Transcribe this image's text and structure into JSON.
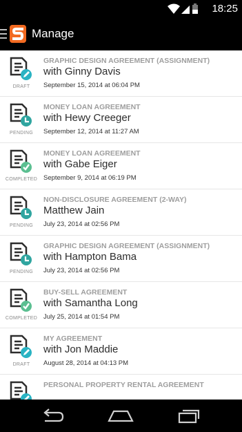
{
  "status_bar": {
    "time": "18:25",
    "icons": [
      "wifi-icon",
      "signal-icon",
      "battery-icon"
    ]
  },
  "app_bar": {
    "title": "Manage",
    "menu_icon": "hamburger-icon",
    "logo_icon": "s-logo-icon",
    "accent_color": "#f26a21"
  },
  "colors": {
    "draft": "#29b3c3",
    "pending": "#2fa5a0",
    "completed": "#5bbf91"
  },
  "agreements": [
    {
      "type": "GRAPHIC DESIGN AGREEMENT (ASSIGNMENT)",
      "party": "with Ginny Davis",
      "date": "September 15, 2014 at 06:04 PM",
      "status": "DRAFT",
      "badge_icon": "pencil-icon"
    },
    {
      "type": "MONEY LOAN AGREEMENT",
      "party": "with Hewy Creeger",
      "date": "September 12, 2014 at 11:27 AM",
      "status": "PENDING",
      "badge_icon": "clock-icon"
    },
    {
      "type": "MONEY LOAN AGREEMENT",
      "party": "with Gabe Eiger",
      "date": "September 9, 2014 at 06:19 PM",
      "status": "COMPLETED",
      "badge_icon": "checkmark-icon"
    },
    {
      "type": "NON-DISCLOSURE AGREEMENT (2-WAY)",
      "party": "Matthew Jain",
      "date": "July 23, 2014 at 02:56 PM",
      "status": "PENDING",
      "badge_icon": "clock-icon"
    },
    {
      "type": "GRAPHIC DESIGN AGREEMENT (ASSIGNMENT)",
      "party": "with Hampton Bama",
      "date": "July 23, 2014 at 02:56 PM",
      "status": "PENDING",
      "badge_icon": "clock-icon"
    },
    {
      "type": "BUY-SELL AGREEMENT",
      "party": "with Samantha Long",
      "date": "July 25, 2014 at 01:54 PM",
      "status": "COMPLETED",
      "badge_icon": "checkmark-icon"
    },
    {
      "type": "MY AGREEMENT",
      "party": "with Jon Maddie",
      "date": "August 28, 2014 at 04:13 PM",
      "status": "DRAFT",
      "badge_icon": "pencil-icon"
    },
    {
      "type": "PERSONAL PROPERTY RENTAL AGREEMENT",
      "party": "",
      "date": "",
      "status": "",
      "badge_icon": "pencil-icon"
    }
  ],
  "nav_bar": {
    "buttons": [
      "back-icon",
      "home-icon",
      "recent-apps-icon"
    ]
  }
}
